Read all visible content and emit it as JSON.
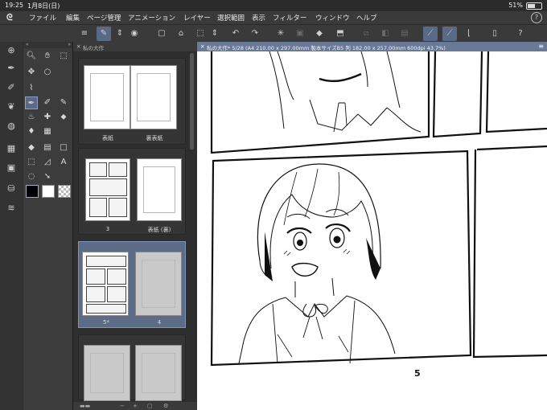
{
  "status": {
    "time": "19:25",
    "date": "1月8日(日)",
    "battery": "51%"
  },
  "menu": [
    "ファイル",
    "編集",
    "ページ管理",
    "アニメーション",
    "レイヤー",
    "選択範囲",
    "表示",
    "フィルター",
    "ウィンドウ",
    "ヘルプ"
  ],
  "pages_panel": {
    "tab_title": "私の大作"
  },
  "pages": [
    {
      "left": "表紙",
      "right": "裏表紙"
    },
    {
      "left": "3",
      "right": "表紙 (裏)"
    },
    {
      "left": "5*",
      "right": "4",
      "selected_left": true
    },
    {
      "left": "",
      "right": ""
    }
  ],
  "document": {
    "tab_title": "私の大作* 5/28 (A4 210.00 x 297.00mm 製本サイズB5 判 182.00 x 257.00mm 600dpi 43.7%)",
    "page_number": "5"
  },
  "colors": {
    "menubar": "#3a3a3a",
    "accent": "#5a6a86",
    "canvas": "#ffffff"
  }
}
